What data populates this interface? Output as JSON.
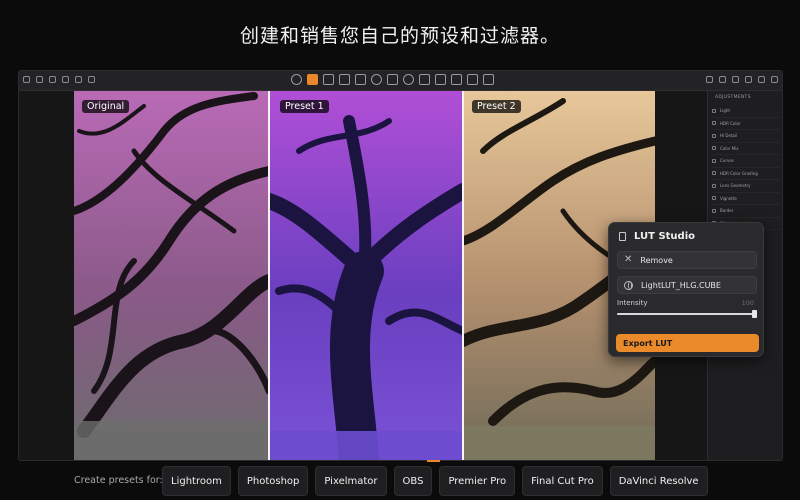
{
  "headline": "创建和销售您自己的预设和过滤器。",
  "panel": {
    "title": "ADJUSTMENTS",
    "items": [
      "Light",
      "HDR Color",
      "Hi Detail",
      "Color Mix",
      "Curves",
      "HDR Color Grading",
      "Lens Geometry",
      "Vignette",
      "Border",
      "Effects"
    ]
  },
  "labels": {
    "original": "Original",
    "preset1": "Preset 1",
    "preset2": "Preset 2"
  },
  "lut_studio": {
    "title": "LUT Studio",
    "remove_label": "Remove",
    "lut_file": "LightLUT_HLG.CUBE",
    "intensity_label": "Intensity",
    "intensity_value": "100",
    "intensity_fraction": 1.0,
    "export_label": "Export LUT"
  },
  "bottom": {
    "create_label": "Create presets for:",
    "apps": [
      "Lightroom",
      "Photoshop",
      "Pixelmator",
      "OBS",
      "Premier Pro",
      "Final Cut Pro",
      "DaVinci Resolve"
    ]
  },
  "colors": {
    "accent": "#ea8a2b",
    "original_tint": "#c46fc0",
    "preset1_tint": "#7a3fd0",
    "preset2_tint": "#d9b587"
  }
}
